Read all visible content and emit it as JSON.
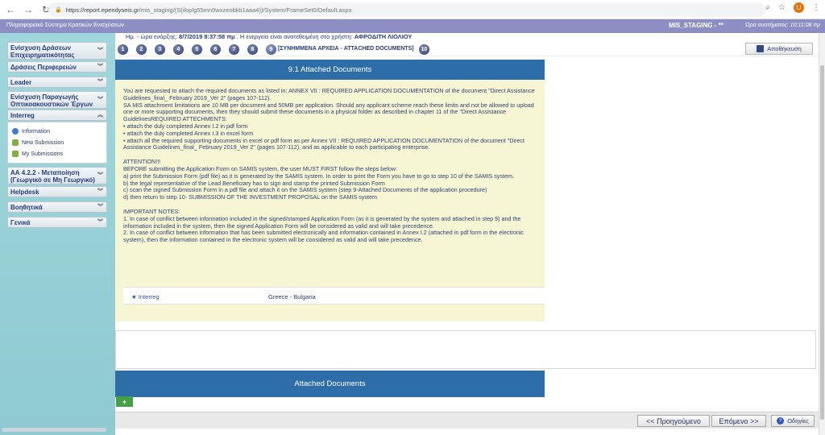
{
  "browser": {
    "url_host": "https://report.ependyseis.gr",
    "url_path": "/mis_staging/(S(iloplg55mn0wxzeobkb1aaa4))/System/FrameSet0/Default.aspx",
    "profile_initial": "U"
  },
  "app": {
    "title": "Πληροφοριακό Σύστημα Κρατικών Ενισχύσεων",
    "env_name": "MIS_STAGING - **",
    "system_time": "Ώρα συστήματος: 10:11:08 πμ"
  },
  "sidebar": {
    "items": [
      {
        "label": "Ενίσχυση Δράσεων Επιχειρηματικότητας"
      },
      {
        "label": "Δράσεις Περιφερειών"
      },
      {
        "label": "Leader"
      },
      {
        "label": "Ενίσχυση Παραγωγής Οπτικοακουστικών Έργων"
      },
      {
        "label": "Interreg"
      },
      {
        "label": "ΑΑ 4.2.2 - Μεταποίηση (Γεωργικό σε Μη Γεωργικό)"
      },
      {
        "label": "Helpdesk"
      },
      {
        "label": "Βοηθητικά"
      },
      {
        "label": "Γενικά"
      }
    ],
    "submenu": [
      {
        "label": "Information"
      },
      {
        "label": "New Submission"
      },
      {
        "label": "My Submissions"
      }
    ]
  },
  "main": {
    "info_prefix": "Ημ. - ώρα ενάρξης:",
    "info_date": "8/7/2019 8:37:58 πμ",
    "info_middle": ". Η ενεργεία είναι ανατεθειμένη στο χρήστη:",
    "info_user": "ΑΦΡΟΔΙΤΗ ΛΙΟΛΙΟΥ",
    "steps": [
      "1",
      "2",
      "3",
      "4",
      "5",
      "6",
      "7",
      "8",
      "9",
      "10"
    ],
    "step_label": "[ΣΥΝΗΜΜΕΝΑ ΑΡΧΕΙΑ - ATTACHED DOCUMENTS]",
    "save_label": "Αποθήκευση",
    "panel_title": "9.1 Attached Documents",
    "body_paragraphs": [
      "You are requested to attach the required documents as listed in: ANNEX VII : REQUIRED APPLICATION DOCUMENTATION of the document \"Direct Assistance Guidelines_final_ February 2019_Ver 2\" (pages 107-112).\nSA MIS attachment limitations are 10 MB per document and 50MB per application. Should any applicant scheme reach these limits and not be allowed to upload one or more supporting documents, then they should submit these documents in a physical folder as described in chapter 11 of the \"Direct Assistance GuidelinesREQUIRED ATTECHMENTS:\n• attach the duly completed Annex I.2 in pdf form\n• attach the duly completed Annex I.3 in excel form\n• attach all the required supporting documents in excel or pdf form as per Annex VII : REQUIRED APPLICATION DOCUMENTATION of the document \"Direct Assistance Guidelines_final_ February 2019_Ver 2\" (pages 107-112), and as applicable to each participating enterprise.",
      "ATTENTION!!!\nBEFORE submitting the Application Form on SAMIS system, the user MUST FIRST follow the steps below:\na) print the Submission Form (pdf file) as it is generated by the SAMIS system. In order to print the Form you have to go to step 10 of the SAMIS system.\nb) the legal representative of the Lead Beneficiary has to sign and stamp the printed Submission Form\nc) scan the signed Submission Form in a pdf file and attach it on the SAMIS system (step 9-Attached Documents of the application procedure)\nd) then return to step 10- SUBMISSION OF THE INVESTMENT PROPOSAL on the SAMIS system",
      "IMPORTANT NOTES:\n1. In case of conflict between information included in the signed/stamped Application Form (as it is generated by the system and attached in step 9) and the information included in the system, then the signed Application Form will be considered as valid and will take precedence.\n2. In case of conflict between information that has been submitted electronically and information contained in Annex I.2 (attached in pdf form in the electronic system), then the information contained in the electronic system will be considered as valid and will take precedence."
    ],
    "program_name": "★ Interreg",
    "program_region": "Greece - Bulgaria",
    "attached_title": "Attached Documents",
    "add_label": "+",
    "prev_label": "<< Προηγούμενο",
    "next_label": "Επόμενο >>",
    "help_label": "Οδηγίες"
  }
}
